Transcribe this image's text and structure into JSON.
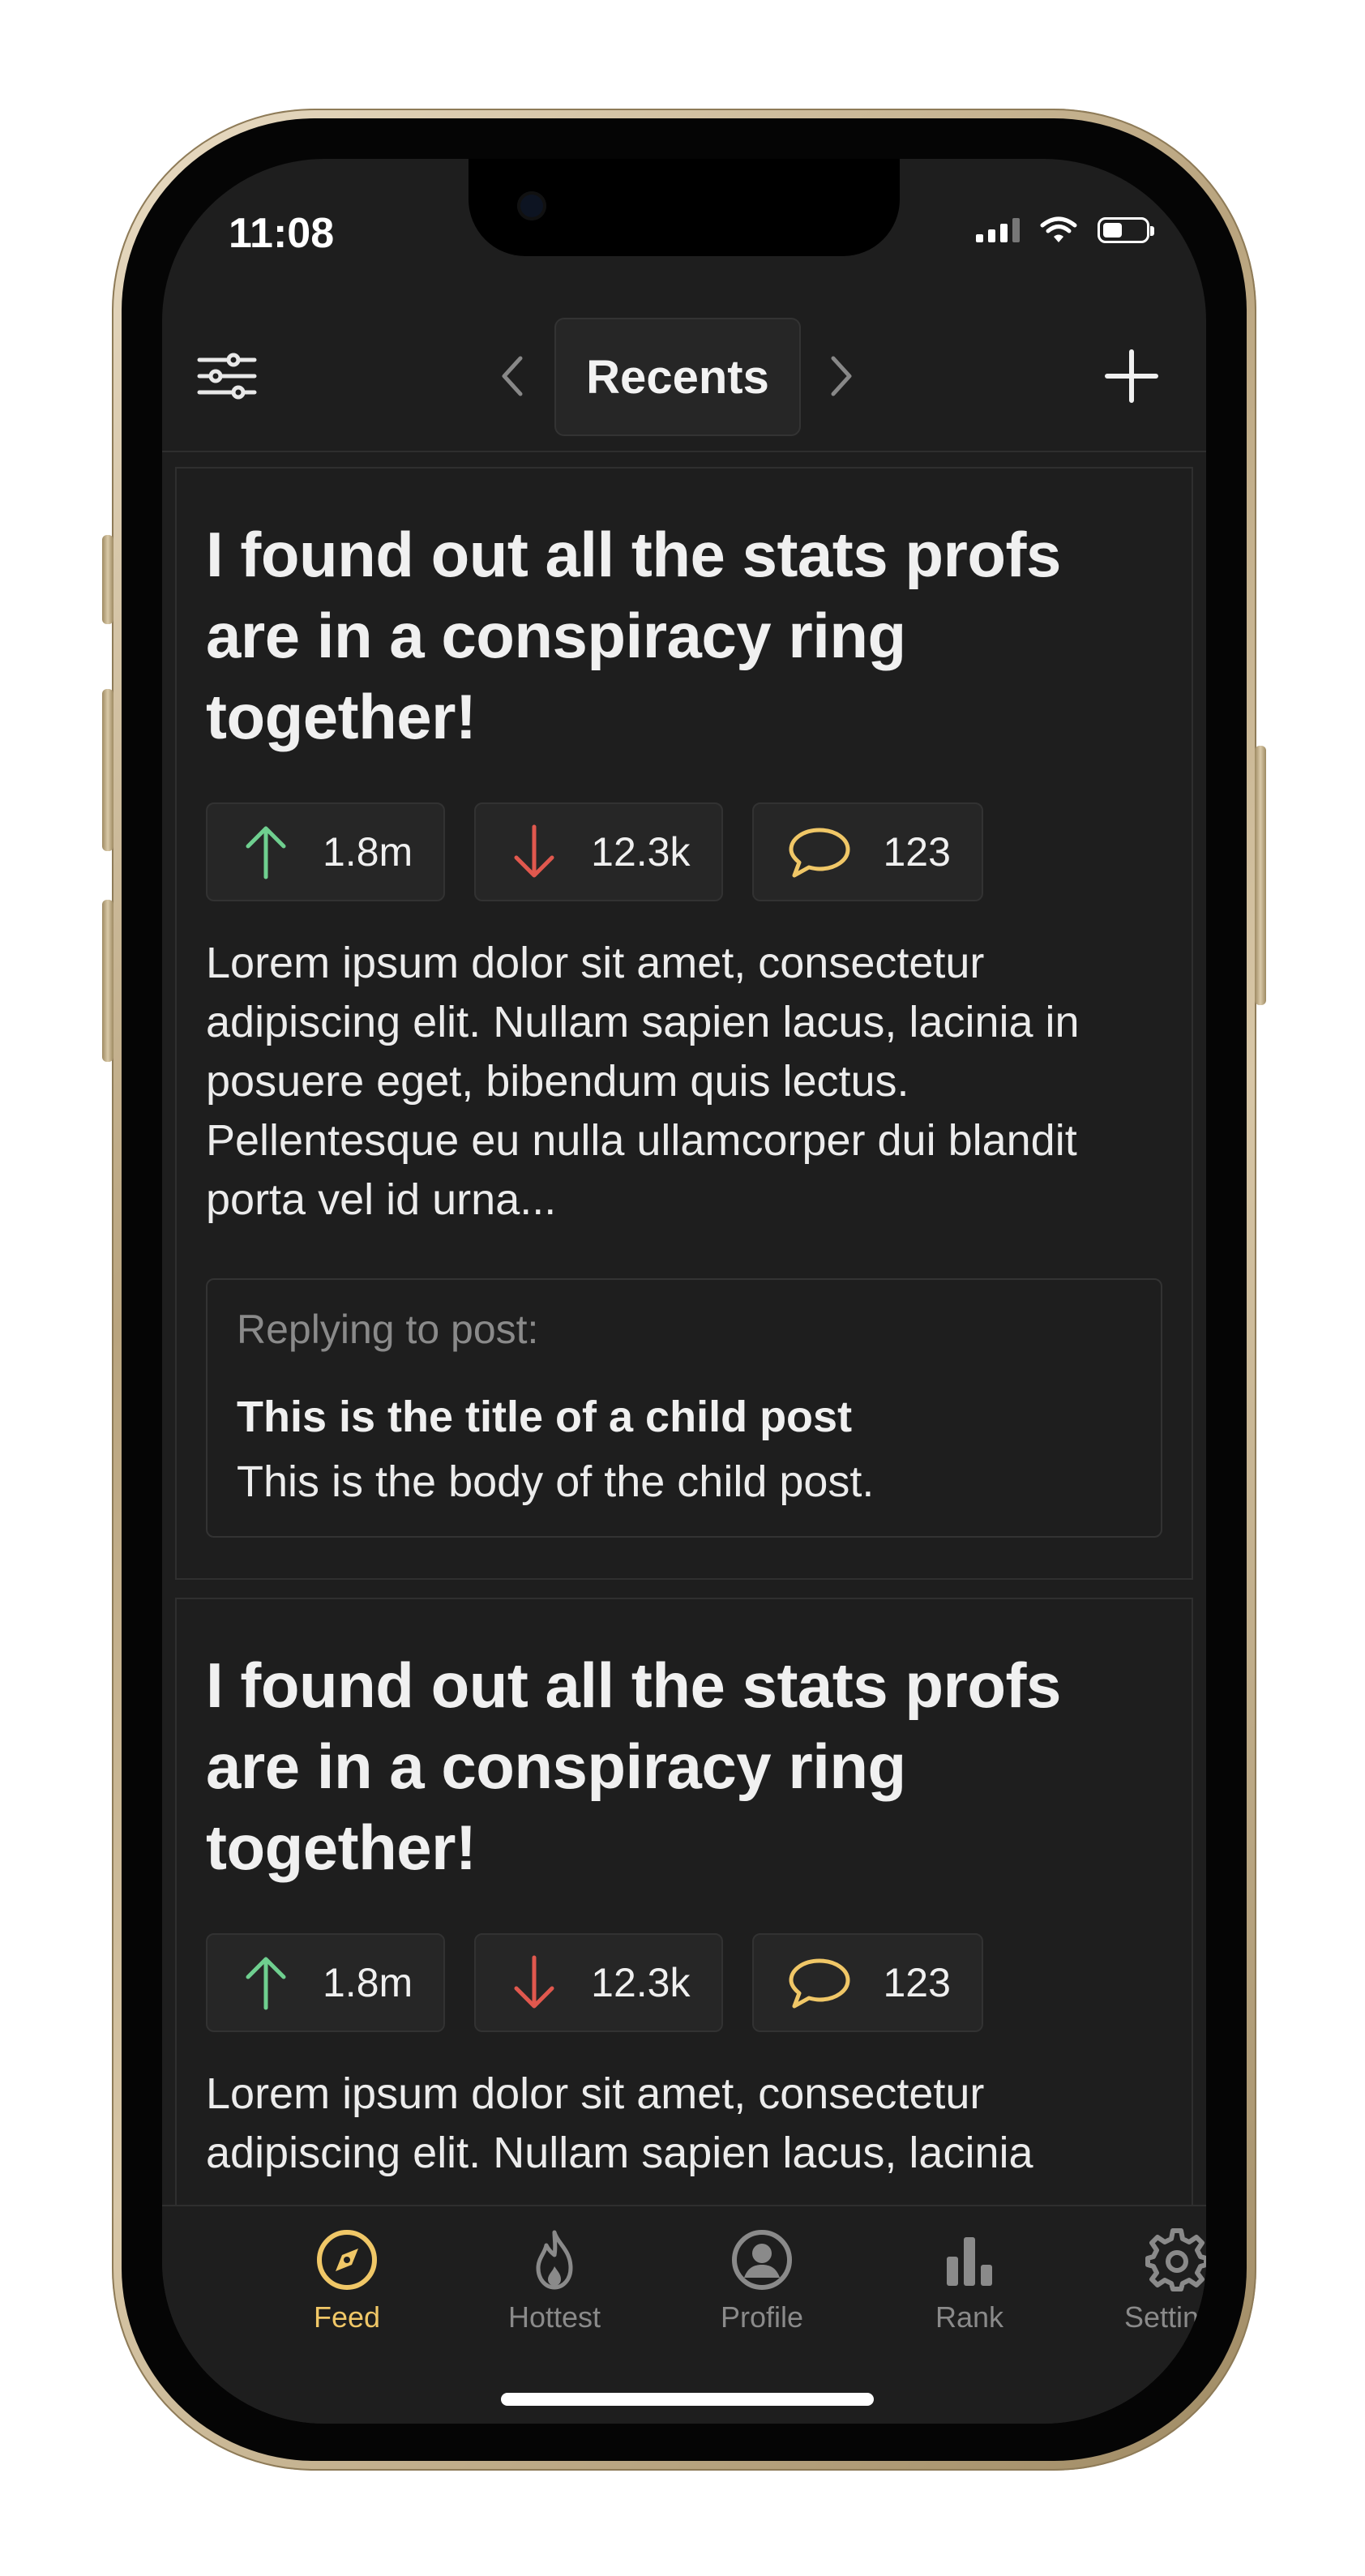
{
  "status": {
    "time": "11:08"
  },
  "header": {
    "title": "Recents"
  },
  "posts": [
    {
      "title": "I found out all the stats profs are in a conspiracy ring together!",
      "upvotes": "1.8m",
      "downvotes": "12.3k",
      "comments": "123",
      "body": "Lorem ipsum dolor sit amet, consectetur adipiscing elit. Nullam sapien lacus, lacinia in posuere eget, bibendum quis lectus. Pellentesque eu nulla ullamcorper dui blandit porta vel id urna...",
      "reply": {
        "label": "Replying to post:",
        "title": "This is the title of a child post",
        "body": "This is the body of the child post."
      }
    },
    {
      "title": "I found out all the stats profs are in a conspiracy ring together!",
      "upvotes": "1.8m",
      "downvotes": "12.3k",
      "comments": "123",
      "body": "Lorem ipsum dolor sit amet, consectetur adipiscing elit. Nullam sapien lacus, lacinia"
    }
  ],
  "tabs": [
    {
      "label": "Feed",
      "icon": "compass-icon",
      "active": true
    },
    {
      "label": "Hottest",
      "icon": "flame-icon",
      "active": false
    },
    {
      "label": "Profile",
      "icon": "user-circle-icon",
      "active": false
    },
    {
      "label": "Rank",
      "icon": "bar-chart-icon",
      "active": false
    },
    {
      "label": "Settings",
      "icon": "gear-icon",
      "active": false
    }
  ],
  "colors": {
    "accent": "#f0c767",
    "upvote": "#6fcf8f",
    "downvote": "#e0584e",
    "comment": "#f0c767",
    "background": "#1e1e1e"
  }
}
